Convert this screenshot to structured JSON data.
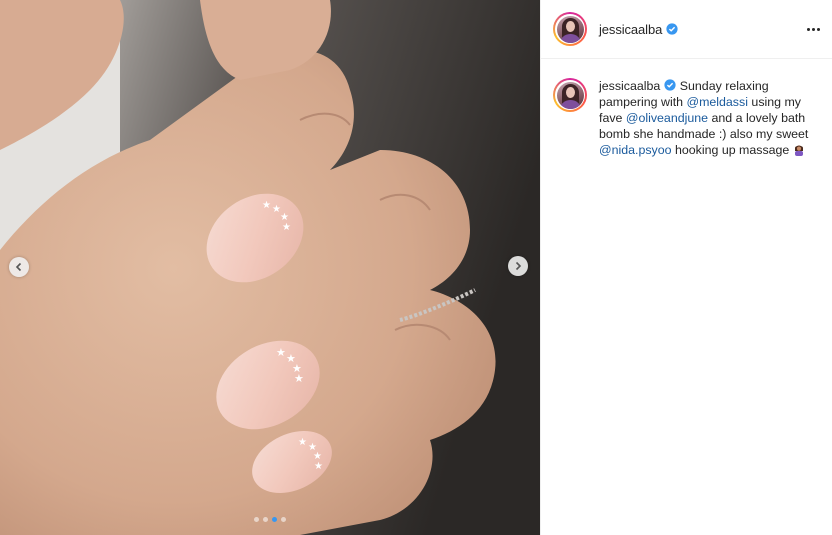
{
  "post": {
    "username": "jessicaalba",
    "caption": {
      "intro": "Sunday relaxing pampering with",
      "mention1": "@meldassi",
      "mid1": "using my fave",
      "mention2": "@oliveandjune",
      "mid2": "and a lovely bath bomb she handmade :) also my sweet",
      "mention3": "@nida.psyoo",
      "outro": "hooking up massage"
    },
    "carousel": {
      "slide_count": 4,
      "active_slide": 3
    }
  },
  "icons": {
    "verified": "verified-badge-icon",
    "more": "more-options-icon",
    "prev": "chevron-left-icon",
    "next": "chevron-right-icon",
    "emoji": "person-getting-massage-emoji"
  },
  "colors": {
    "verified_blue": "#3897f0",
    "mention_blue": "#1a5a9c",
    "text": "#262626"
  }
}
